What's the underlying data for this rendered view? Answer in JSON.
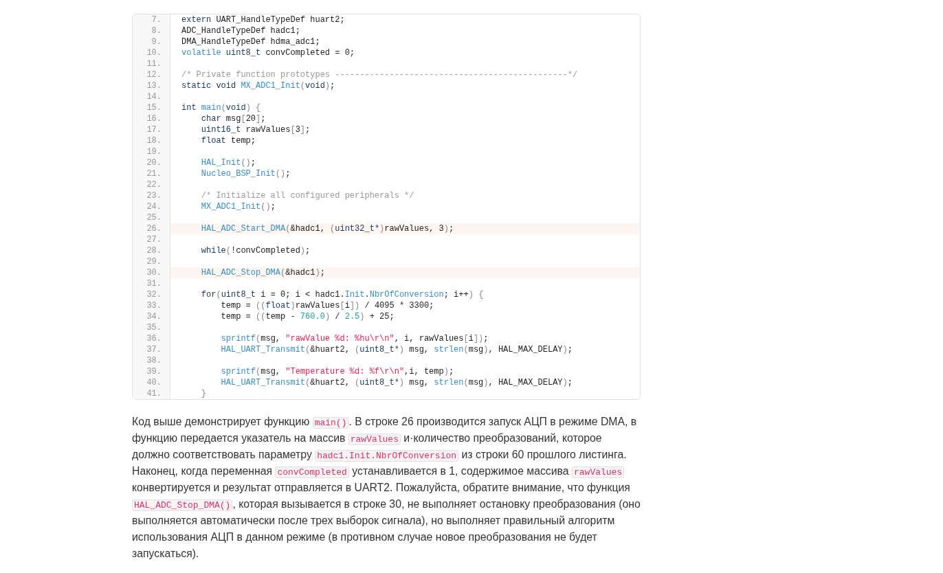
{
  "code_listing": {
    "lines": [
      {
        "number": "7.",
        "highlighted": false,
        "tokens": [
          {
            "kind": "keyword",
            "text": "extern"
          },
          {
            "kind": "plain",
            "text": " UART_HandleTypeDef huart2;"
          }
        ]
      },
      {
        "number": "8.",
        "highlighted": false,
        "tokens": [
          {
            "kind": "plain",
            "text": "ADC_HandleTypeDef hadc1;"
          }
        ]
      },
      {
        "number": "9.",
        "highlighted": false,
        "tokens": [
          {
            "kind": "plain",
            "text": "DMA_HandleTypeDef hdma_adc1;"
          }
        ]
      },
      {
        "number": "10.",
        "highlighted": false,
        "tokens": [
          {
            "kind": "function",
            "text": "volatile"
          },
          {
            "kind": "keyword",
            "text": " uint8_t"
          },
          {
            "kind": "plain",
            "text": " convCompleted = 0;"
          }
        ]
      },
      {
        "number": "11.",
        "highlighted": false
      },
      {
        "number": "12.",
        "highlighted": false,
        "tokens": [
          {
            "kind": "comment",
            "text": "/* Private function prototypes -----------------------------------------------*/"
          }
        ]
      },
      {
        "number": "13.",
        "highlighted": false,
        "tokens": [
          {
            "kind": "keyword",
            "text": "static void"
          },
          {
            "kind": "function",
            "text": " MX_ADC1_Init"
          },
          {
            "kind": "punct",
            "text": "("
          },
          {
            "kind": "keyword",
            "text": "void"
          },
          {
            "kind": "punct",
            "text": ")"
          },
          {
            "kind": "plain",
            "text": ";"
          }
        ]
      },
      {
        "number": "14.",
        "highlighted": false
      },
      {
        "number": "15.",
        "highlighted": false,
        "tokens": [
          {
            "kind": "keyword",
            "text": "int"
          },
          {
            "kind": "function",
            "text": " main"
          },
          {
            "kind": "punct",
            "text": "("
          },
          {
            "kind": "keyword",
            "text": "void"
          },
          {
            "kind": "punct",
            "text": ") {"
          }
        ]
      },
      {
        "number": "16.",
        "highlighted": false,
        "tokens": [
          {
            "kind": "keyword",
            "text": "    char"
          },
          {
            "kind": "plain",
            "text": " msg"
          },
          {
            "kind": "punct",
            "text": "["
          },
          {
            "kind": "plain",
            "text": "20"
          },
          {
            "kind": "punct",
            "text": "]"
          },
          {
            "kind": "plain",
            "text": ";"
          }
        ]
      },
      {
        "number": "17.",
        "highlighted": false,
        "tokens": [
          {
            "kind": "keyword",
            "text": "    uint16_t"
          },
          {
            "kind": "plain",
            "text": " rawValues"
          },
          {
            "kind": "punct",
            "text": "["
          },
          {
            "kind": "plain",
            "text": "3"
          },
          {
            "kind": "punct",
            "text": "]"
          },
          {
            "kind": "plain",
            "text": ";"
          }
        ]
      },
      {
        "number": "18.",
        "highlighted": false,
        "tokens": [
          {
            "kind": "keyword",
            "text": "    float"
          },
          {
            "kind": "plain",
            "text": " temp;"
          }
        ]
      },
      {
        "number": "19.",
        "highlighted": false
      },
      {
        "number": "20.",
        "highlighted": false,
        "tokens": [
          {
            "kind": "function",
            "text": "    HAL_Init"
          },
          {
            "kind": "punct",
            "text": "()"
          },
          {
            "kind": "plain",
            "text": ";"
          }
        ]
      },
      {
        "number": "21.",
        "highlighted": false,
        "tokens": [
          {
            "kind": "function",
            "text": "    Nucleo_BSP_Init"
          },
          {
            "kind": "punct",
            "text": "()"
          },
          {
            "kind": "plain",
            "text": ";"
          }
        ]
      },
      {
        "number": "22.",
        "highlighted": false
      },
      {
        "number": "23.",
        "highlighted": false,
        "tokens": [
          {
            "kind": "comment",
            "text": "    /* Initialize all configured peripherals */"
          }
        ]
      },
      {
        "number": "24.",
        "highlighted": false,
        "tokens": [
          {
            "kind": "function",
            "text": "    MX_ADC1_Init"
          },
          {
            "kind": "punct",
            "text": "()"
          },
          {
            "kind": "plain",
            "text": ";"
          }
        ]
      },
      {
        "number": "25.",
        "highlighted": false
      },
      {
        "number": "26.",
        "highlighted": true,
        "tokens": [
          {
            "kind": "function",
            "text": "    HAL_ADC_Start_DMA"
          },
          {
            "kind": "punct",
            "text": "("
          },
          {
            "kind": "plain",
            "text": "&hadc1,"
          },
          {
            "kind": "punct",
            "text": " ("
          },
          {
            "kind": "keyword",
            "text": "uint32_t*"
          },
          {
            "kind": "punct",
            "text": ")"
          },
          {
            "kind": "plain",
            "text": "rawValues, 3"
          },
          {
            "kind": "punct",
            "text": ")"
          },
          {
            "kind": "plain",
            "text": ";"
          }
        ]
      },
      {
        "number": "27.",
        "highlighted": false
      },
      {
        "number": "28.",
        "highlighted": false,
        "tokens": [
          {
            "kind": "keyword",
            "text": "    while"
          },
          {
            "kind": "punct",
            "text": "("
          },
          {
            "kind": "plain",
            "text": "!convCompleted"
          },
          {
            "kind": "punct",
            "text": ")"
          },
          {
            "kind": "plain",
            "text": ";"
          }
        ]
      },
      {
        "number": "29.",
        "highlighted": false
      },
      {
        "number": "30.",
        "highlighted": true,
        "tokens": [
          {
            "kind": "function",
            "text": "    HAL_ADC_Stop_DMA"
          },
          {
            "kind": "punct",
            "text": "("
          },
          {
            "kind": "plain",
            "text": "&hadc1"
          },
          {
            "kind": "punct",
            "text": ")"
          },
          {
            "kind": "plain",
            "text": ";"
          }
        ]
      },
      {
        "number": "31.",
        "highlighted": false
      },
      {
        "number": "32.",
        "highlighted": false,
        "tokens": [
          {
            "kind": "keyword",
            "text": "    for"
          },
          {
            "kind": "punct",
            "text": "("
          },
          {
            "kind": "keyword",
            "text": "uint8_t"
          },
          {
            "kind": "plain",
            "text": " i = 0; i < hadc1."
          },
          {
            "kind": "function",
            "text": "Init"
          },
          {
            "kind": "plain",
            "text": "."
          },
          {
            "kind": "function",
            "text": "NbrOfConversion"
          },
          {
            "kind": "plain",
            "text": "; i++"
          },
          {
            "kind": "punct",
            "text": ") {"
          }
        ]
      },
      {
        "number": "33.",
        "highlighted": false,
        "tokens": [
          {
            "kind": "plain",
            "text": "        temp ="
          },
          {
            "kind": "punct",
            "text": " (("
          },
          {
            "kind": "keyword",
            "text": "float"
          },
          {
            "kind": "punct",
            "text": ")"
          },
          {
            "kind": "plain",
            "text": "rawValues"
          },
          {
            "kind": "punct",
            "text": "["
          },
          {
            "kind": "plain",
            "text": "i"
          },
          {
            "kind": "punct",
            "text": "])"
          },
          {
            "kind": "plain",
            "text": " / 4095 * 3300;"
          }
        ]
      },
      {
        "number": "34.",
        "highlighted": false,
        "tokens": [
          {
            "kind": "plain",
            "text": "        temp ="
          },
          {
            "kind": "punct",
            "text": " (("
          },
          {
            "kind": "plain",
            "text": "temp -"
          },
          {
            "kind": "number",
            "text": " 760.0"
          },
          {
            "kind": "punct",
            "text": ")"
          },
          {
            "kind": "plain",
            "text": " /"
          },
          {
            "kind": "number",
            "text": " 2.5"
          },
          {
            "kind": "punct",
            "text": ")"
          },
          {
            "kind": "plain",
            "text": " + 25;"
          }
        ]
      },
      {
        "number": "35.",
        "highlighted": false
      },
      {
        "number": "36.",
        "highlighted": false,
        "tokens": [
          {
            "kind": "function",
            "text": "        sprintf"
          },
          {
            "kind": "punct",
            "text": "("
          },
          {
            "kind": "plain",
            "text": "msg,"
          },
          {
            "kind": "string",
            "text": " \"rawValue %d: %hu\\r\\n\""
          },
          {
            "kind": "plain",
            "text": ", i, rawValues"
          },
          {
            "kind": "punct",
            "text": "["
          },
          {
            "kind": "plain",
            "text": "i"
          },
          {
            "kind": "punct",
            "text": "])"
          },
          {
            "kind": "plain",
            "text": ";"
          }
        ]
      },
      {
        "number": "37.",
        "highlighted": false,
        "tokens": [
          {
            "kind": "function",
            "text": "        HAL_UART_Transmit"
          },
          {
            "kind": "punct",
            "text": "("
          },
          {
            "kind": "plain",
            "text": "&huart2,"
          },
          {
            "kind": "punct",
            "text": " ("
          },
          {
            "kind": "keyword",
            "text": "uint8_t*"
          },
          {
            "kind": "punct",
            "text": ")"
          },
          {
            "kind": "plain",
            "text": " msg,"
          },
          {
            "kind": "function",
            "text": " strlen"
          },
          {
            "kind": "punct",
            "text": "("
          },
          {
            "kind": "plain",
            "text": "msg"
          },
          {
            "kind": "punct",
            "text": ")"
          },
          {
            "kind": "plain",
            "text": ", HAL_MAX_DELAY"
          },
          {
            "kind": "punct",
            "text": ")"
          },
          {
            "kind": "plain",
            "text": ";"
          }
        ]
      },
      {
        "number": "38.",
        "highlighted": false
      },
      {
        "number": "39.",
        "highlighted": false,
        "tokens": [
          {
            "kind": "function",
            "text": "        sprintf"
          },
          {
            "kind": "punct",
            "text": "("
          },
          {
            "kind": "plain",
            "text": "msg,"
          },
          {
            "kind": "string",
            "text": " \"Temperature %d: %f\\r\\n\""
          },
          {
            "kind": "plain",
            "text": ",i, temp"
          },
          {
            "kind": "punct",
            "text": ")"
          },
          {
            "kind": "plain",
            "text": ";"
          }
        ]
      },
      {
        "number": "40.",
        "highlighted": false,
        "tokens": [
          {
            "kind": "function",
            "text": "        HAL_UART_Transmit"
          },
          {
            "kind": "punct",
            "text": "("
          },
          {
            "kind": "plain",
            "text": "&huart2,"
          },
          {
            "kind": "punct",
            "text": " ("
          },
          {
            "kind": "keyword",
            "text": "uint8_t*"
          },
          {
            "kind": "punct",
            "text": ")"
          },
          {
            "kind": "plain",
            "text": " msg,"
          },
          {
            "kind": "function",
            "text": " strlen"
          },
          {
            "kind": "punct",
            "text": "("
          },
          {
            "kind": "plain",
            "text": "msg"
          },
          {
            "kind": "punct",
            "text": ")"
          },
          {
            "kind": "plain",
            "text": ", HAL_MAX_DELAY"
          },
          {
            "kind": "punct",
            "text": ")"
          },
          {
            "kind": "plain",
            "text": ";"
          }
        ]
      },
      {
        "number": "41.",
        "highlighted": false,
        "tokens": [
          {
            "kind": "punct",
            "text": "    }"
          }
        ]
      }
    ]
  },
  "paragraph": [
    {
      "kind": "text",
      "text": "Код выше демонстрирует функцию "
    },
    {
      "kind": "code",
      "text": "main()"
    },
    {
      "kind": "text",
      "text": ". В строке 26 производится запуск АЦП в режиме DMA, в функцию передается указатель на массив "
    },
    {
      "kind": "code",
      "text": "rawValues"
    },
    {
      "kind": "text",
      "text": " и·количество преобразований, которое должно соответствовать параметру "
    },
    {
      "kind": "code",
      "text": "hadc1.Init.NbrOfConversion"
    },
    {
      "kind": "text",
      "text": " из строки 60 прошлого листинга. Наконец, когда переменная "
    },
    {
      "kind": "code",
      "text": "convCompleted"
    },
    {
      "kind": "text",
      "text": " устанавливается в 1, содержимое массива "
    },
    {
      "kind": "code",
      "text": "rawValues"
    },
    {
      "kind": "text",
      "text": " конвертируется и результат отправляется в UART2. Пожалуйста, обратите внимание, что функция "
    },
    {
      "kind": "code",
      "text": "HAL_ADC_Stop_DMA()"
    },
    {
      "kind": "text",
      "text": ", которая вызывается в строке 30, не выполняет остановку преобразования (оно выполняется автоматически после трех выборок сигнала), но выполняет правильный алгоритм использования АЦП в данном режиме (в противном случае новое преобразования не будет запускаться)."
    }
  ]
}
